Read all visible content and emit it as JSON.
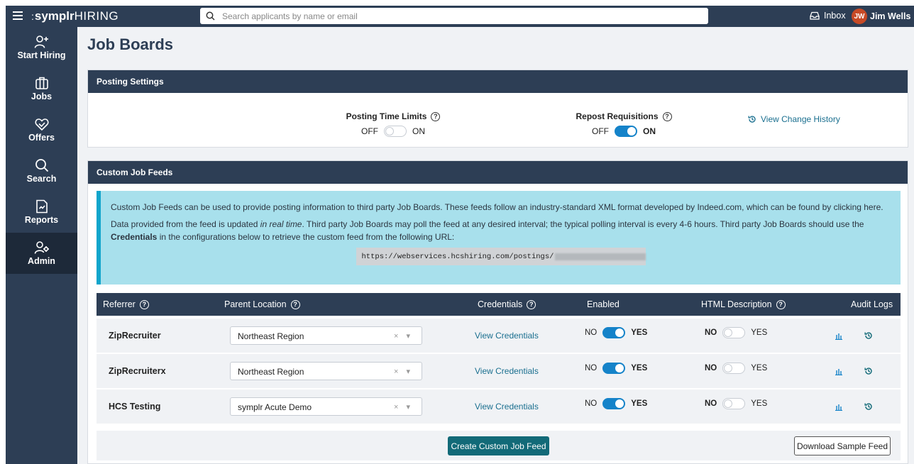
{
  "app": {
    "logo_brand": "symplr",
    "logo_product": "HIRING",
    "search_placeholder": "Search applicants by name or email",
    "inbox_label": "Inbox",
    "user_initials": "JW",
    "user_name": "Jim Wells"
  },
  "sidebar": {
    "items": [
      {
        "label": "Start Hiring",
        "icon": "person-plus-icon"
      },
      {
        "label": "Jobs",
        "icon": "briefcase-icon"
      },
      {
        "label": "Offers",
        "icon": "handshake-heart-icon"
      },
      {
        "label": "Search",
        "icon": "search-icon"
      },
      {
        "label": "Reports",
        "icon": "report-icon"
      },
      {
        "label": "Admin",
        "icon": "person-gear-icon",
        "active": true
      }
    ]
  },
  "page": {
    "title": "Job Boards"
  },
  "posting_settings": {
    "header": "Posting Settings",
    "time_limits": {
      "label": "Posting Time Limits",
      "off": "OFF",
      "on": "ON",
      "value": false
    },
    "repost": {
      "label": "Repost Requisitions",
      "off": "OFF",
      "on": "ON",
      "value": true
    },
    "history_link": "View Change History"
  },
  "custom_feeds": {
    "header": "Custom Job Feeds",
    "info_p1": "Custom Job Feeds can be used to provide posting information to third party Job Boards. These feeds follow an industry-standard XML format developed by Indeed.com, which can be found by clicking here.",
    "info_p2_a": "Data provided from the feed is updated ",
    "info_p2_em": "in real time",
    "info_p2_b": ". Third party Job Boards may poll the feed at any desired interval; the typical polling interval is every 4-6 hours. Third party Job Boards should use the ",
    "info_p2_strong": "Credentials",
    "info_p2_c": " in the configurations below to retrieve the custom feed from the following URL:",
    "feed_url": "https://webservices.hcshiring.com/postings/",
    "columns": {
      "referrer": "Referrer",
      "parent_location": "Parent Location",
      "credentials": "Credentials",
      "enabled": "Enabled",
      "html_description": "HTML Description",
      "audit_logs": "Audit Logs"
    },
    "rows": [
      {
        "referrer": "ZipRecruiter",
        "location": "Northeast Region",
        "credentials": "View Credentials",
        "no": "NO",
        "yes": "YES",
        "enabled": true,
        "html_description": false
      },
      {
        "referrer": "ZipRecruiterx",
        "location": "Northeast Region",
        "credentials": "View Credentials",
        "no": "NO",
        "yes": "YES",
        "enabled": true,
        "html_description": false
      },
      {
        "referrer": "HCS Testing",
        "location": "symplr Acute Demo",
        "credentials": "View Credentials",
        "no": "NO",
        "yes": "YES",
        "enabled": true,
        "html_description": false
      }
    ],
    "create_button": "Create Custom Job Feed",
    "download_button": "Download Sample Feed"
  },
  "colors": {
    "navy": "#2d3e55",
    "teal_button": "#126a78",
    "toggle_on": "#1583c9",
    "info_bg": "#a8e0ec",
    "link": "#1a6f8f",
    "avatar": "#c74a26"
  }
}
